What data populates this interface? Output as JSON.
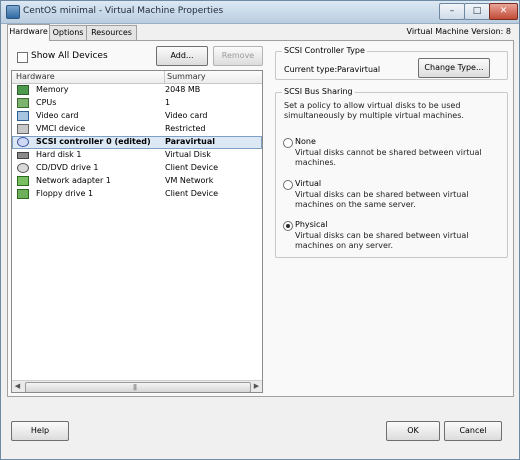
{
  "window": {
    "title": "CentOS minimal - Virtual Machine Properties",
    "min_glyph": "–",
    "max_glyph": "□",
    "close_glyph": "✕"
  },
  "tabs": [
    "Hardware",
    "Options",
    "Resources"
  ],
  "vm_version": "Virtual Machine Version: 8",
  "hardware": {
    "show_all_devices_label": "Show All Devices",
    "add_button": "Add...",
    "remove_button": "Remove",
    "columns": {
      "hardware": "Hardware",
      "summary": "Summary"
    },
    "rows": [
      {
        "icon": "memory-icon",
        "name": "Memory",
        "summary": "2048 MB"
      },
      {
        "icon": "cpu-icon",
        "name": "CPUs",
        "summary": "1"
      },
      {
        "icon": "video-card-icon",
        "name": "Video card",
        "summary": "Video card"
      },
      {
        "icon": "vmci-device-icon",
        "name": "VMCI device",
        "summary": "Restricted"
      },
      {
        "icon": "scsi-controller-icon",
        "name": "SCSI controller 0 (edited)",
        "summary": "Paravirtual"
      },
      {
        "icon": "hard-disk-icon",
        "name": "Hard disk 1",
        "summary": "Virtual Disk"
      },
      {
        "icon": "cd-dvd-icon",
        "name": "CD/DVD drive 1",
        "summary": "Client Device"
      },
      {
        "icon": "network-adapter-icon",
        "name": "Network adapter 1",
        "summary": "VM Network"
      },
      {
        "icon": "floppy-icon",
        "name": "Floppy drive 1",
        "summary": "Client Device"
      }
    ],
    "selected_index": 4,
    "scroll": {
      "left_arrow": "◀",
      "right_arrow": "▶",
      "grip": "|||"
    }
  },
  "scsi_controller_type": {
    "title": "SCSI Controller Type",
    "current_type_label": "Current type:",
    "current_type_value": "Paravirtual",
    "change_type_button": "Change Type..."
  },
  "scsi_bus_sharing": {
    "title": "SCSI Bus Sharing",
    "intro": "Set a policy to allow virtual disks to be used simultaneously by multiple virtual machines.",
    "options": [
      {
        "label": "None",
        "description": "Virtual disks cannot be shared between virtual machines.",
        "checked": false
      },
      {
        "label": "Virtual",
        "description": "Virtual disks can be shared between virtual machines on the same server.",
        "checked": false
      },
      {
        "label": "Physical",
        "description": "Virtual disks can be shared between virtual machines on any server.",
        "checked": true
      }
    ]
  },
  "footer": {
    "help": "Help",
    "ok": "OK",
    "cancel": "Cancel"
  }
}
